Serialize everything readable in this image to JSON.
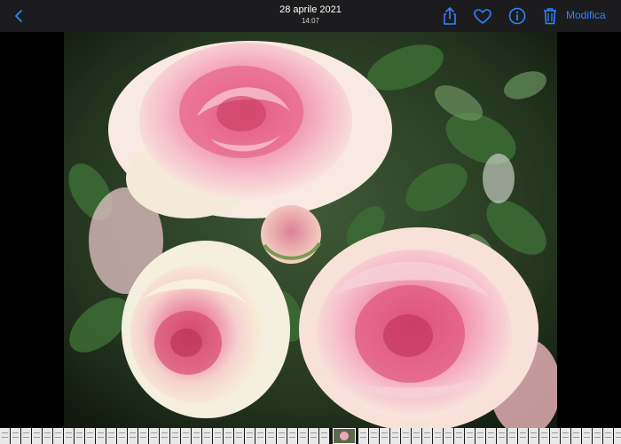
{
  "header": {
    "date": "28 aprile 2021",
    "time": "14:07",
    "edit_label": "Modifica"
  },
  "icons": {
    "back": "chevron-left-icon",
    "share": "share-icon",
    "favorite": "heart-icon",
    "info": "info-icon",
    "delete": "trash-icon"
  },
  "colors": {
    "accent": "#2f84ff",
    "toolbar": "#1c1c1e",
    "background": "#000000"
  },
  "photo": {
    "subject": "pink roses"
  },
  "filmstrip": {
    "thumbnail_count": 62,
    "current_index": 31
  }
}
